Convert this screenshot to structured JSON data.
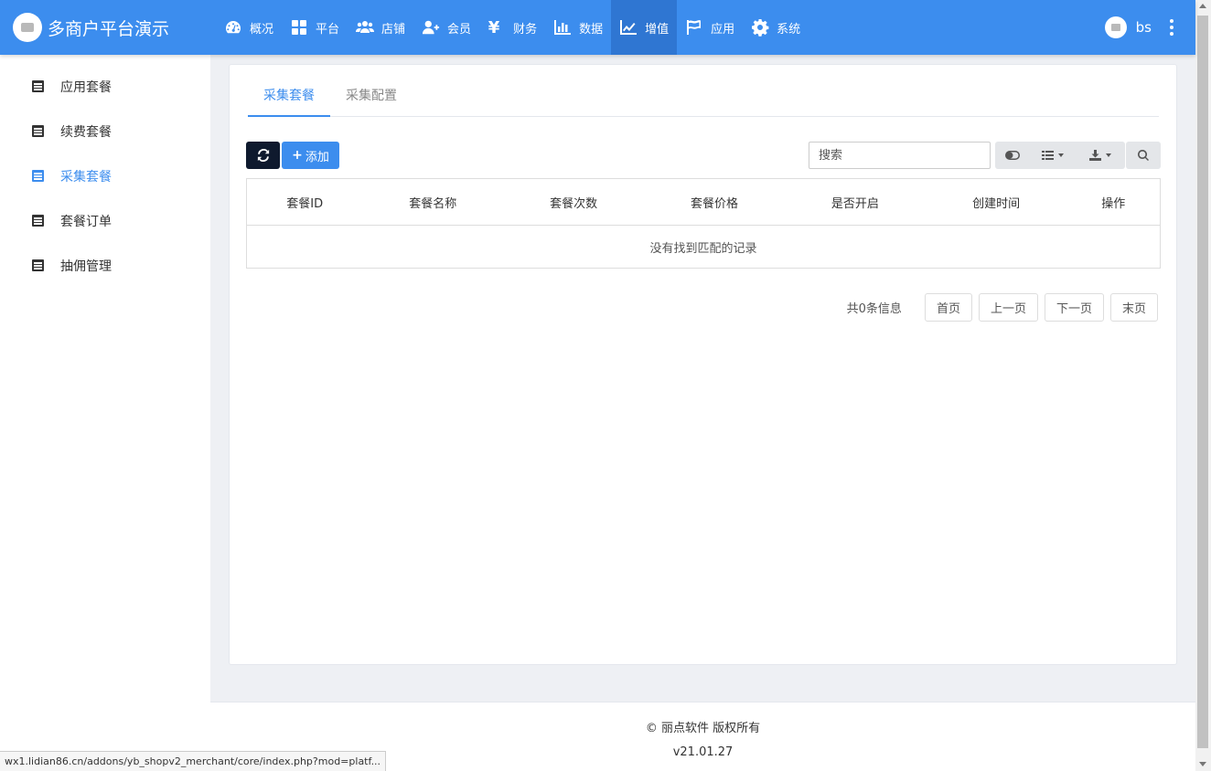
{
  "brand": {
    "title": "多商户平台演示"
  },
  "nav": [
    {
      "label": "概况",
      "icon": "dashboard-icon"
    },
    {
      "label": "平台",
      "icon": "grid-icon"
    },
    {
      "label": "店铺",
      "icon": "users-icon"
    },
    {
      "label": "会员",
      "icon": "user-plus-icon"
    },
    {
      "label": "财务",
      "icon": "yen-icon"
    },
    {
      "label": "数据",
      "icon": "bar-chart-icon"
    },
    {
      "label": "增值",
      "icon": "line-chart-icon",
      "active": true
    },
    {
      "label": "应用",
      "icon": "flag-icon"
    },
    {
      "label": "系统",
      "icon": "gear-icon"
    }
  ],
  "user": {
    "name": "bs"
  },
  "sidebar": {
    "items": [
      {
        "label": "应用套餐"
      },
      {
        "label": "续费套餐"
      },
      {
        "label": "采集套餐",
        "active": true
      },
      {
        "label": "套餐订单"
      },
      {
        "label": "抽佣管理"
      }
    ]
  },
  "tabs": [
    {
      "label": "采集套餐",
      "active": true
    },
    {
      "label": "采集配置"
    }
  ],
  "toolbar": {
    "add_label": "添加",
    "search_placeholder": "搜索"
  },
  "table": {
    "headers": [
      "套餐ID",
      "套餐名称",
      "套餐次数",
      "套餐价格",
      "是否开启",
      "创建时间",
      "操作"
    ],
    "empty_text": "没有找到匹配的记录"
  },
  "pager": {
    "info": "共0条信息",
    "first": "首页",
    "prev": "上一页",
    "next": "下一页",
    "last": "末页"
  },
  "footer": {
    "copyright": "© 丽点软件 版权所有",
    "version": "v21.01.27"
  },
  "statusbar": {
    "url": "wx1.lidian86.cn/addons/yb_shopv2_merchant/core/index.php?mod=platf..."
  },
  "colors": {
    "primary": "#3c8dee",
    "active_nav": "#2f76d2",
    "dark_button": "#0f1a2e"
  }
}
